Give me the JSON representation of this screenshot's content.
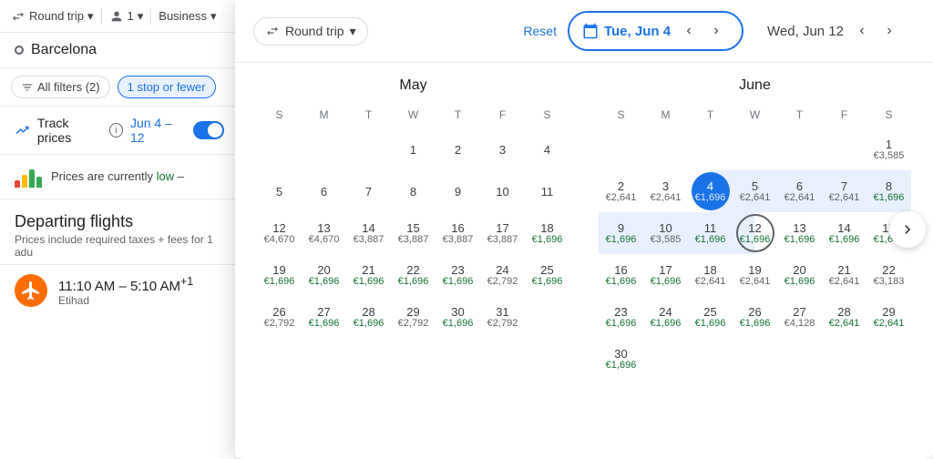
{
  "topBar": {
    "tripType": "Round trip",
    "passengers": "1",
    "cabinClass": "Business"
  },
  "sidebar": {
    "searchCity": "Barcelona",
    "filters": {
      "allFilters": "All filters (2)",
      "stopFilter": "1 stop or fewer"
    },
    "trackPrices": {
      "label": "Track prices",
      "range": "Jun 4 – 12"
    },
    "pricesBanner": "Prices are currently low –",
    "pricesLow": "low",
    "departing": {
      "title": "Departing flights",
      "subtitle": "Prices include required taxes + fees for 1 adu",
      "flight": {
        "time": "11:10 AM – 5:10 AM",
        "suffix": "+1",
        "airline": "Etihad"
      }
    }
  },
  "calendarPanel": {
    "tripTypeLabel": "Round trip",
    "resetLabel": "Reset",
    "date1": "Tue, Jun 4",
    "date2": "Wed, Jun 12",
    "months": {
      "may": {
        "title": "May",
        "dows": [
          "S",
          "M",
          "T",
          "W",
          "T",
          "F",
          "S"
        ],
        "weeks": [
          [
            null,
            null,
            null,
            1,
            2,
            3,
            4
          ],
          [
            5,
            6,
            7,
            8,
            9,
            10,
            11
          ],
          [
            12,
            13,
            14,
            15,
            16,
            17,
            18
          ],
          [
            19,
            20,
            21,
            22,
            23,
            24,
            25
          ],
          [
            26,
            27,
            28,
            29,
            30,
            31,
            null
          ]
        ],
        "prices": {
          "1": null,
          "2": null,
          "3": null,
          "4": null,
          "5": null,
          "6": null,
          "7": null,
          "8": null,
          "9": null,
          "10": null,
          "11": null,
          "12": "€4,670",
          "13": "€4,670",
          "14": "€3,887",
          "15": "€3,887",
          "16": "€3,887",
          "17": "€3,887",
          "18": "€1,696",
          "19": "€1,696",
          "20": "€1,696",
          "21": "€1,696",
          "22": "€1,696",
          "23": "€1,696",
          "24": "€2,792",
          "25": "€1,696",
          "26": "€2,792",
          "27": "€1,696",
          "28": "€1,696",
          "29": "€2,792",
          "30": "€1,696",
          "31": "€2,792"
        },
        "priceColors": {
          "18": "green",
          "19": "green",
          "20": "green",
          "21": "green",
          "22": "green",
          "23": "green",
          "25": "green",
          "27": "green",
          "28": "green",
          "30": "green"
        }
      },
      "june": {
        "title": "June",
        "dows": [
          "S",
          "M",
          "T",
          "W",
          "T",
          "F",
          "S"
        ],
        "weeks": [
          [
            null,
            null,
            null,
            null,
            null,
            null,
            1
          ],
          [
            2,
            3,
            4,
            5,
            6,
            7,
            8
          ],
          [
            9,
            10,
            11,
            12,
            13,
            14,
            15
          ],
          [
            16,
            17,
            18,
            19,
            20,
            21,
            22
          ],
          [
            23,
            24,
            25,
            26,
            27,
            28,
            29
          ],
          [
            30,
            null,
            null,
            null,
            null,
            null,
            null
          ]
        ],
        "prices": {
          "1": "€3,585",
          "2": "€2,641",
          "3": "€2,641",
          "4": "€1,696",
          "5": "€2,641",
          "6": "€2,641",
          "7": "€2,641",
          "8": "€1,696",
          "9": "€1,696",
          "10": "€3,585",
          "11": "€1,696",
          "12": "€1,696",
          "13": "€1,696",
          "14": "€1,696",
          "15": "€1,696",
          "16": "€1,696",
          "17": "€1,696",
          "18": "€2,641",
          "19": "€2,641",
          "20": "€1,696",
          "21": "€2,641",
          "22": "€3,183",
          "23": "€1,696",
          "24": "€1,696",
          "25": "€1,696",
          "26": "€1,696",
          "27": "€4,128",
          "28": "€2,641",
          "29": "€2,641",
          "30": "€1,696"
        },
        "priceColors": {
          "4": "green",
          "8": "green",
          "9": "green",
          "11": "green",
          "12": "green",
          "13": "green",
          "14": "green",
          "15": "green",
          "16": "green",
          "17": "green",
          "20": "green",
          "23": "green",
          "24": "green",
          "25": "green",
          "26": "green",
          "28": "green",
          "29": "green",
          "30": "green"
        },
        "selectedStart": 4,
        "selectedEnd": 12,
        "rangeStart": 4,
        "rangeEnd": 12
      }
    }
  },
  "icons": {
    "chevronDown": "▾",
    "person": "👤",
    "calendar": "📅",
    "trendingUp": "📈",
    "chevronLeft": "‹",
    "chevronRight": "›",
    "chevronRightArrow": "❯"
  }
}
